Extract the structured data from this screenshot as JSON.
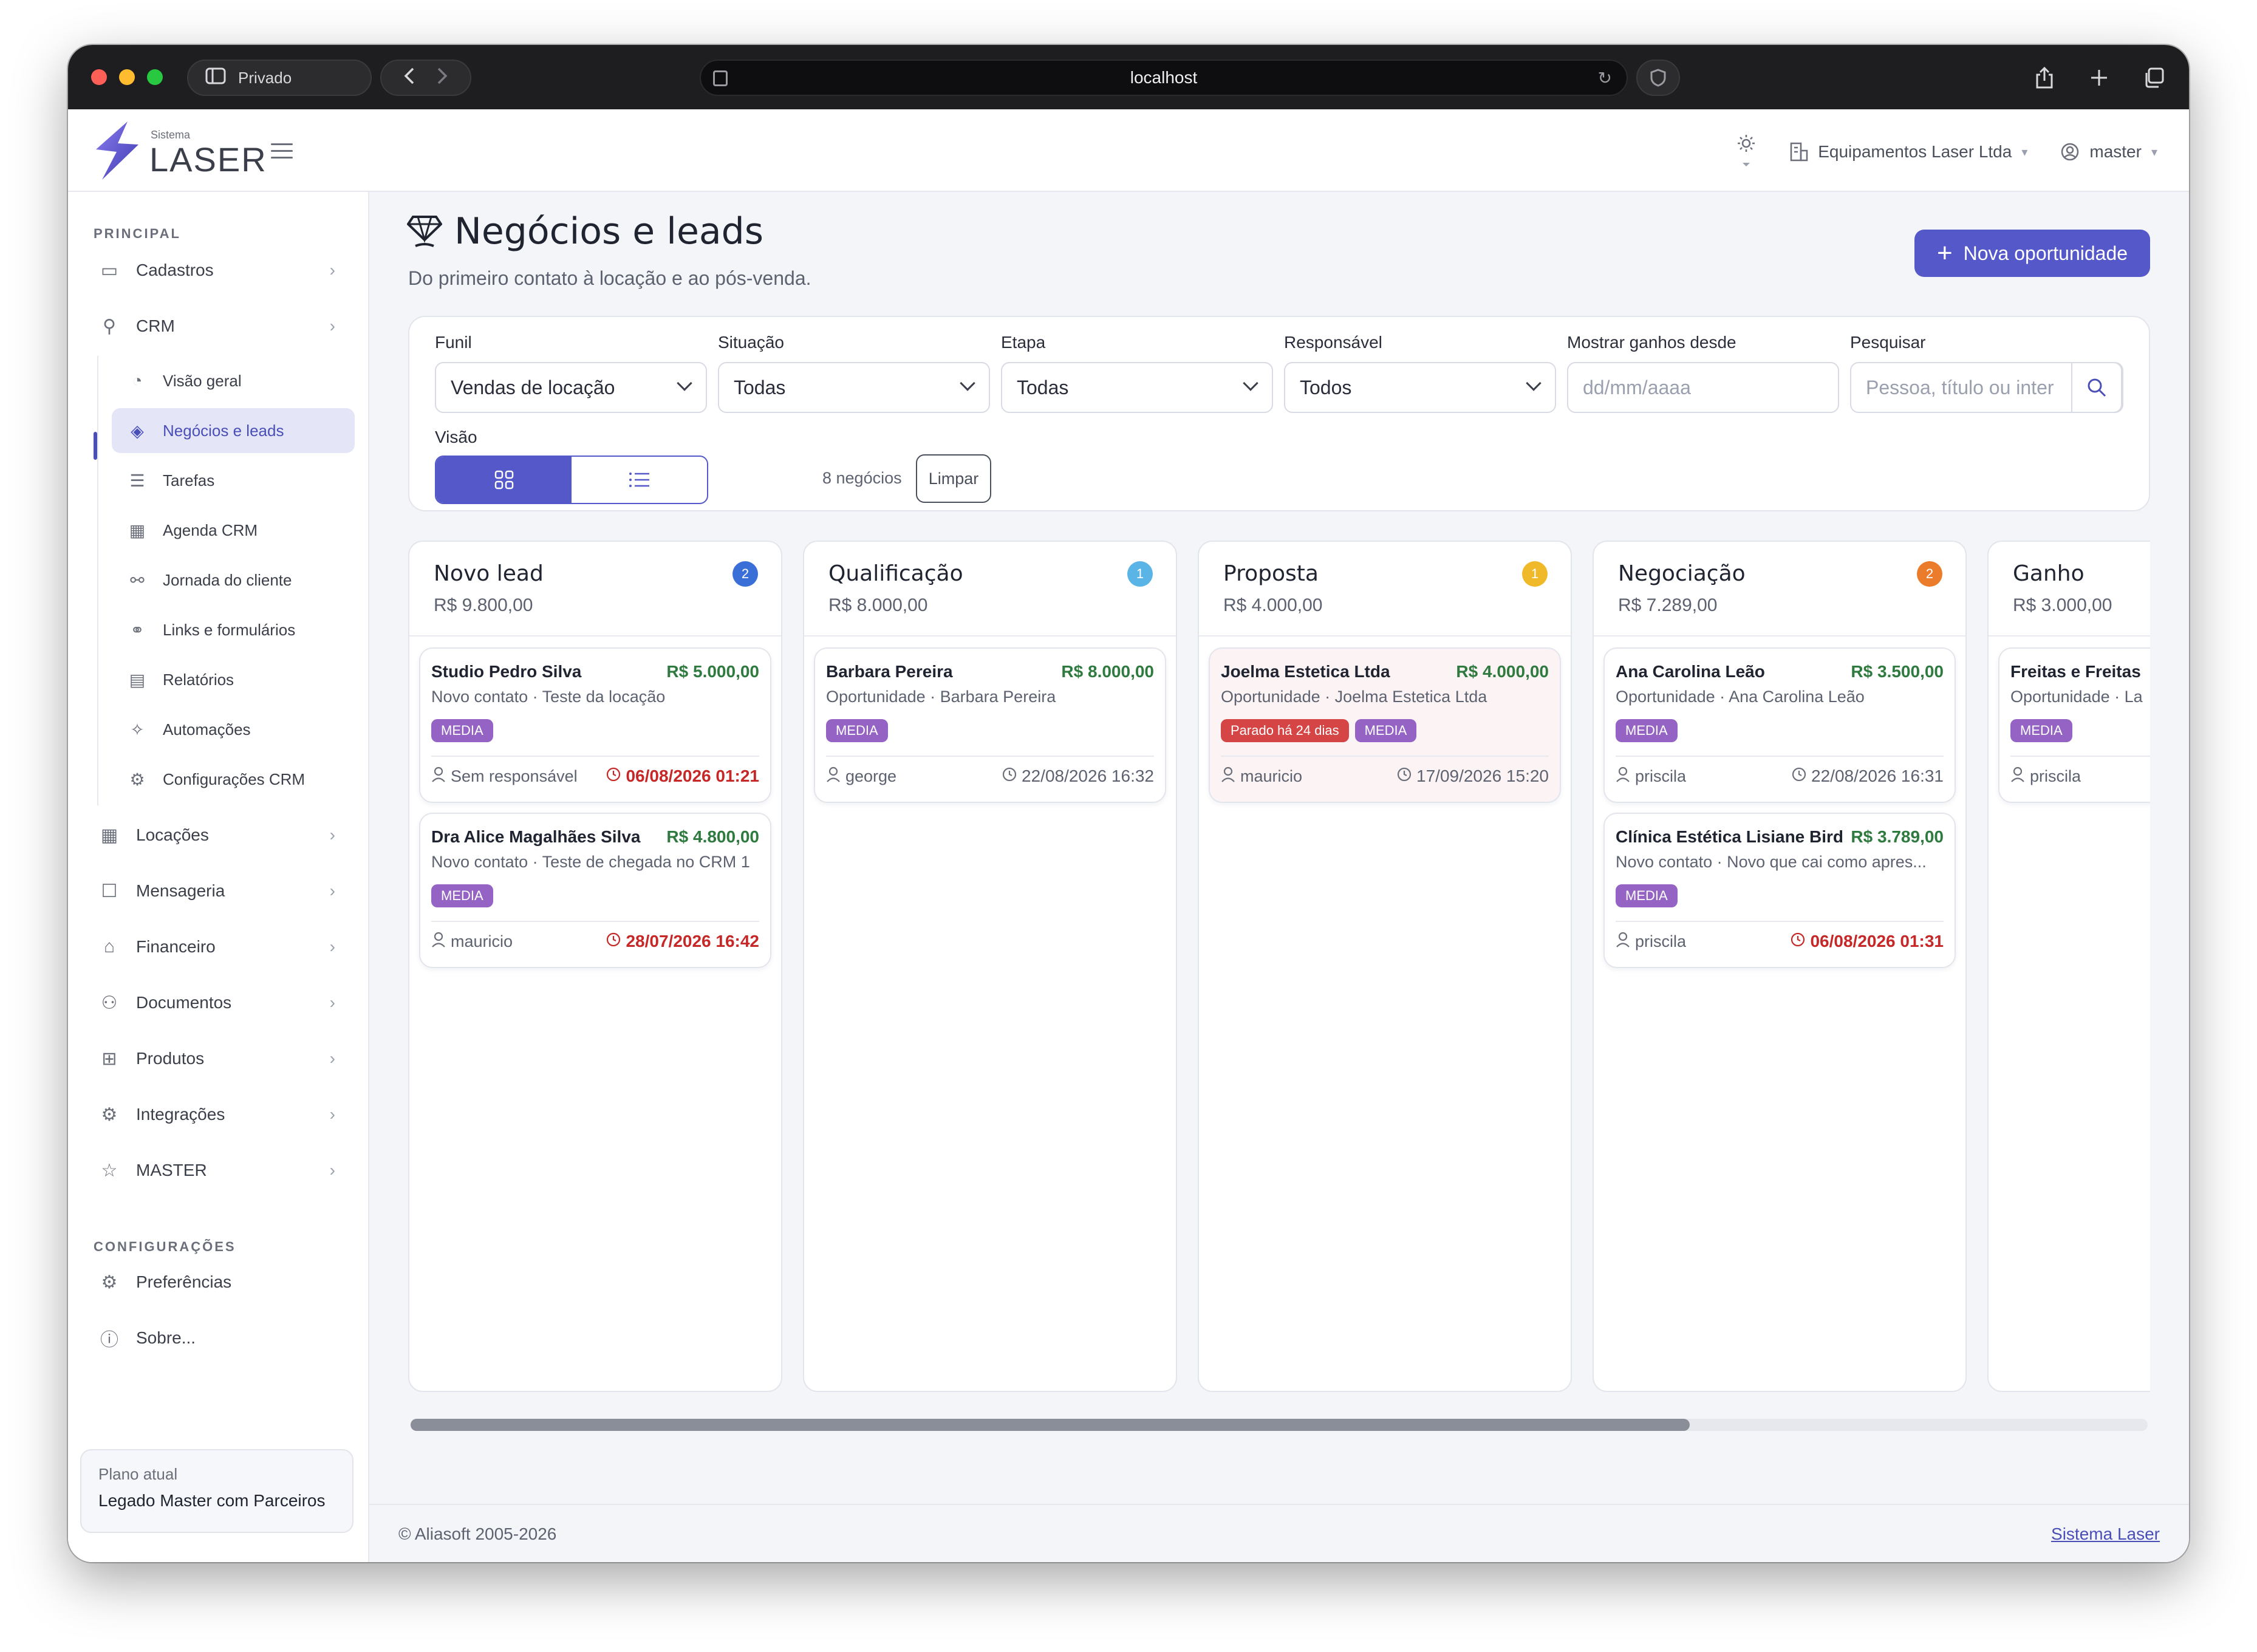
{
  "browser": {
    "private_label": "Privado",
    "url": "localhost"
  },
  "app": {
    "logo_small": "Sistema",
    "logo_big": "LASER",
    "company": "Equipamentos Laser Ltda",
    "user": "master"
  },
  "sidebar": {
    "section_main": "PRINCIPAL",
    "section_config": "CONFIGURAÇÕES",
    "items": [
      {
        "label": "Cadastros",
        "icon": "folder-icon"
      },
      {
        "label": "CRM",
        "icon": "crm-icon"
      },
      {
        "label": "Locações",
        "icon": "calendar-icon"
      },
      {
        "label": "Mensageria",
        "icon": "chat-icon"
      },
      {
        "label": "Financeiro",
        "icon": "finance-icon"
      },
      {
        "label": "Documentos",
        "icon": "documents-icon"
      },
      {
        "label": "Produtos",
        "icon": "products-icon"
      },
      {
        "label": "Integrações",
        "icon": "integrations-icon"
      },
      {
        "label": "MASTER",
        "icon": "master-icon"
      }
    ],
    "crm_sub": [
      {
        "label": "Visão geral",
        "icon": "gauge-icon"
      },
      {
        "label": "Negócios e leads",
        "icon": "diamond-icon"
      },
      {
        "label": "Tarefas",
        "icon": "checklist-icon"
      },
      {
        "label": "Agenda CRM",
        "icon": "calendar-icon"
      },
      {
        "label": "Jornada do cliente",
        "icon": "journey-icon"
      },
      {
        "label": "Links e formulários",
        "icon": "link-icon"
      },
      {
        "label": "Relatórios",
        "icon": "report-icon"
      },
      {
        "label": "Automações",
        "icon": "wand-icon"
      },
      {
        "label": "Configurações CRM",
        "icon": "gear-icon"
      }
    ],
    "config_items": [
      {
        "label": "Preferências",
        "icon": "settings-icon"
      },
      {
        "label": "Sobre...",
        "icon": "info-icon"
      }
    ],
    "plan_label": "Plano atual",
    "plan_value": "Legado Master com Parceiros"
  },
  "page": {
    "title": "Negócios e leads",
    "subtitle": "Do primeiro contato à locação e ao pós-venda.",
    "new_button": "Nova oportunidade"
  },
  "filters": {
    "funnel_label": "Funil",
    "funnel_value": "Vendas de locação",
    "status_label": "Situação",
    "status_value": "Todas",
    "stage_label": "Etapa",
    "stage_value": "Todas",
    "owner_label": "Responsável",
    "owner_value": "Todos",
    "since_label": "Mostrar ganhos desde",
    "since_placeholder": "dd/mm/aaaa",
    "search_label": "Pesquisar",
    "search_placeholder": "Pessoa, título ou inter",
    "view_label": "Visão",
    "count_text": "8 negócios",
    "clear_button": "Limpar"
  },
  "columns": [
    {
      "title": "Novo lead",
      "total": "R$ 9.800,00",
      "count": "2",
      "badge_color": "#3b6fd8",
      "cards": [
        {
          "name": "Studio Pedro Silva",
          "value": "R$ 5.000,00",
          "sub": "Novo contato · Teste da locação",
          "tag": "MEDIA",
          "owner": "Sem responsável",
          "date": "06/08/2026 01:21"
        },
        {
          "name": "Dra Alice Magalhães Silva",
          "value": "R$ 4.800,00",
          "sub": "Novo contato · Teste de chegada no CRM 1",
          "tag": "MEDIA",
          "owner": "mauricio",
          "date": "28/07/2026 16:42"
        }
      ]
    },
    {
      "title": "Qualificação",
      "total": "R$ 8.000,00",
      "count": "1",
      "badge_color": "#5bb4e6",
      "cards": [
        {
          "name": "Barbara Pereira",
          "value": "R$ 8.000,00",
          "sub": "Oportunidade · Barbara Pereira",
          "tag": "MEDIA",
          "owner": "george",
          "date": "22/08/2026 16:32"
        }
      ]
    },
    {
      "title": "Proposta",
      "total": "R$ 4.000,00",
      "count": "1",
      "badge_color": "#f0b92a",
      "cards": [
        {
          "name": "Joelma Estetica Ltda",
          "value": "R$ 4.000,00",
          "sub": "Oportunidade · Joelma Estetica Ltda",
          "stall": "Parado há 24 dias",
          "tag": "MEDIA",
          "owner": "mauricio",
          "date": "17/09/2026 15:20"
        }
      ]
    },
    {
      "title": "Negociação",
      "total": "R$ 7.289,00",
      "count": "2",
      "badge_color": "#ea7c2b",
      "cards": [
        {
          "name": "Ana Carolina Leão",
          "value": "R$ 3.500,00",
          "sub": "Oportunidade · Ana Carolina Leão",
          "tag": "MEDIA",
          "owner": "priscila",
          "date": "22/08/2026 16:31"
        },
        {
          "name": "Clínica Estética Lisiane Bird",
          "value": "R$ 3.789,00",
          "sub": "Novo contato · Novo que cai como apres...",
          "tag": "MEDIA",
          "owner": "priscila",
          "date": "06/08/2026 01:31"
        }
      ]
    },
    {
      "title": "Ganho",
      "total": "R$ 3.000,00",
      "cards": [
        {
          "name": "Freitas e Freitas",
          "sub": "Oportunidade · La",
          "tag": "MEDIA",
          "owner": "priscila"
        }
      ]
    }
  ],
  "footer": {
    "copyright": "© Aliasoft 2005-2026",
    "link": "Sistema Laser"
  },
  "colors": {
    "accent": "#5558c8",
    "value_green": "#2f7a3f",
    "overdue_red": "#c62828",
    "tag_purple": "#9563c4",
    "stall_red": "#d64545"
  }
}
